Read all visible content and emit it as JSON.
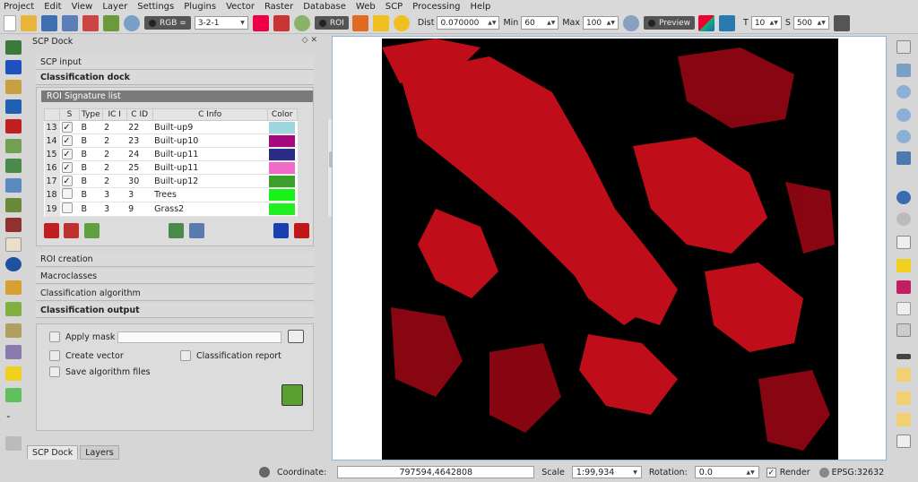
{
  "menubar": [
    "Project",
    "Edit",
    "View",
    "Layer",
    "Settings",
    "Plugins",
    "Vector",
    "Raster",
    "Database",
    "Web",
    "SCP",
    "Processing",
    "Help"
  ],
  "toolbar": {
    "rgb_label": "RGB =",
    "rgb_value": "3-2-1",
    "roi_label": "ROI",
    "dist_label": "Dist",
    "dist_value": "0.070000",
    "min_label": "Min",
    "min_value": "60",
    "max_label": "Max",
    "max_value": "100",
    "preview_label": "Preview",
    "t_label": "T",
    "t_value": "10",
    "s_label": "S",
    "s_value": "500"
  },
  "dock": {
    "title": "SCP Dock",
    "scp_input": "SCP input",
    "classification_dock": "Classification dock",
    "roi_signature_list": "ROI Signature list",
    "columns": [
      "S",
      "Type",
      "IC I",
      "C ID",
      "C Info",
      "Color"
    ],
    "rows": [
      {
        "num": "13",
        "checked": "✓",
        "type": "B",
        "ic": "2",
        "cid": "22",
        "info": "Built-up9",
        "color": "#9ed6df"
      },
      {
        "num": "14",
        "checked": "✓",
        "type": "B",
        "ic": "2",
        "cid": "23",
        "info": "Built-up10",
        "color": "#a5087c"
      },
      {
        "num": "15",
        "checked": "✓",
        "type": "B",
        "ic": "2",
        "cid": "24",
        "info": "Built-up11",
        "color": "#2c2c86"
      },
      {
        "num": "16",
        "checked": "✓",
        "type": "B",
        "ic": "2",
        "cid": "25",
        "info": "Built-up11",
        "color": "#f06ac8"
      },
      {
        "num": "17",
        "checked": "✓",
        "type": "B",
        "ic": "2",
        "cid": "30",
        "info": "Built-up12",
        "color": "#3aa02a"
      },
      {
        "num": "18",
        "checked": "",
        "type": "B",
        "ic": "3",
        "cid": "3",
        "info": "Trees",
        "color": "#19f219"
      },
      {
        "num": "19",
        "checked": "",
        "type": "B",
        "ic": "3",
        "cid": "9",
        "info": "Grass2",
        "color": "#22ee22"
      }
    ],
    "roi_creation": "ROI creation",
    "macroclasses": "Macroclasses",
    "classification_algorithm": "Classification algorithm",
    "classification_output": "Classification output",
    "apply_mask": "Apply mask",
    "create_vector": "Create vector",
    "classification_report": "Classification report",
    "save_algorithm_files": "Save algorithm files"
  },
  "bottom_tabs": [
    "SCP Dock",
    "Layers"
  ],
  "statusbar": {
    "coordinate_label": "Coordinate:",
    "coordinate_value": "797594,4642808",
    "scale_label": "Scale",
    "scale_value": "1:99,934",
    "rotation_label": "Rotation:",
    "rotation_value": "0.0",
    "render_label": "Render",
    "epsg_label": "EPSG:32632"
  }
}
